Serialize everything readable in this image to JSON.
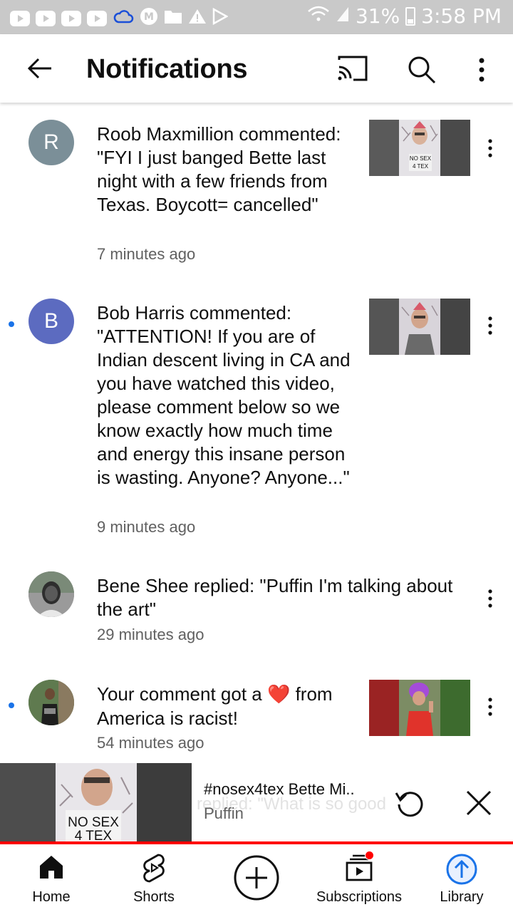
{
  "status_bar": {
    "battery_percent": "31%",
    "time": "3:58 PM",
    "left_icons": [
      "youtube-icon",
      "youtube-icon",
      "youtube-icon",
      "youtube-icon",
      "cloud-icon",
      "m-app-icon",
      "folder-icon",
      "warning-icon",
      "play-store-icon"
    ],
    "right_icons": [
      "wifi-icon",
      "signal-icon",
      "battery-icon"
    ]
  },
  "app_bar": {
    "title": "Notifications",
    "icons": [
      "back-arrow-icon",
      "cast-icon",
      "search-icon",
      "more-vert-icon"
    ]
  },
  "notifications": [
    {
      "avatar_letter": "R",
      "avatar_color": "#7b8f98",
      "unread": false,
      "text": "Roob Maxmillion commented: \"FYI I just banged Bette last night with a few friends from Texas. Boycott= cancelled\"",
      "time": "7 minutes ago",
      "has_thumbnail": true,
      "thumbnail_sign": "NO SEX 4 TEX"
    },
    {
      "avatar_letter": "B",
      "avatar_color": "#5c6bc0",
      "unread": true,
      "text": "Bob Harris commented: \"ATTENTION! If you are of Indian descent living in CA and you have watched this video, please comment below so we know exactly how much time and energy this insane person is wasting. Anyone? Anyone...\"",
      "time": "9 minutes ago",
      "has_thumbnail": true
    },
    {
      "avatar_letter": "",
      "avatar_color": "#6d6d6d",
      "unread": false,
      "text": "Bene Shee replied: \"Puffin I'm talking about the art\"",
      "time": "29 minutes ago",
      "has_thumbnail": false
    },
    {
      "avatar_letter": "",
      "avatar_color": "#4f6b46",
      "unread": true,
      "text_before": "Your comment got a",
      "emoji": "❤️",
      "text_after": "from America is racist!",
      "time": "54 minutes ago",
      "has_thumbnail": true
    }
  ],
  "mini_player": {
    "title": "#nosex4tex Bette Mi..",
    "channel": "Puffin",
    "ghost_text": "replied: \"What is so good",
    "thumbnail_sign": "NO SEX 4 TEX",
    "progress_color": "#ff0000"
  },
  "bottom_nav": {
    "home": "Home",
    "shorts": "Shorts",
    "subscriptions": "Subscriptions",
    "library": "Library"
  },
  "colors": {
    "status_bar": "#c9c9c9",
    "unread_dot": "#1a73e8",
    "secondary_text": "#606060",
    "accent_red": "#ff0000",
    "library_blue": "#1a73e8"
  }
}
